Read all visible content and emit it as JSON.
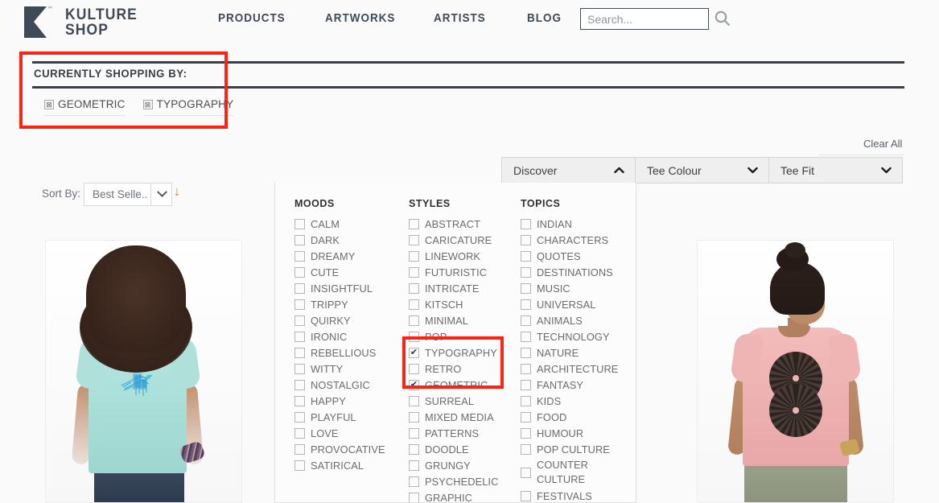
{
  "header": {
    "brand_line1": "KULTURE",
    "brand_line2": "SHOP",
    "brand_tm": "™",
    "nav": [
      {
        "label": "PRODUCTS",
        "name": "nav-products"
      },
      {
        "label": "ARTWORKS",
        "name": "nav-artworks"
      },
      {
        "label": "ARTISTS",
        "name": "nav-artists"
      },
      {
        "label": "BLOG",
        "name": "nav-blog"
      }
    ],
    "search": {
      "value": "",
      "placeholder": "Search...",
      "icon": "search-icon"
    }
  },
  "currently_shopping": {
    "title": "CURRENTLY SHOPPING BY:",
    "chips": [
      {
        "label": "GEOMETRIC",
        "remove_icon": "x-box-icon"
      },
      {
        "label": "TYPOGRAPHY",
        "remove_icon": "x-box-icon"
      }
    ]
  },
  "toolbar": {
    "clear_all": "Clear All",
    "sort_label": "Sort By:",
    "sort_value": "Best Selle..",
    "sort_caret_icon": "chevron-down-icon",
    "sort_direction_icon": "arrow-down-icon",
    "filters": [
      {
        "label": "Discover",
        "icon": "chevron-up-icon",
        "expanded": true
      },
      {
        "label": "Tee Colour",
        "icon": "chevron-down-icon",
        "expanded": false
      },
      {
        "label": "Tee Fit",
        "icon": "chevron-down-icon",
        "expanded": false
      }
    ]
  },
  "discover_panel": {
    "columns": [
      {
        "heading": "MOODS",
        "options": [
          {
            "label": "CALM",
            "checked": false
          },
          {
            "label": "DARK",
            "checked": false
          },
          {
            "label": "DREAMY",
            "checked": false
          },
          {
            "label": "CUTE",
            "checked": false
          },
          {
            "label": "INSIGHTFUL",
            "checked": false
          },
          {
            "label": "TRIPPY",
            "checked": false
          },
          {
            "label": "QUIRKY",
            "checked": false
          },
          {
            "label": "IRONIC",
            "checked": false
          },
          {
            "label": "REBELLIOUS",
            "checked": false
          },
          {
            "label": "WITTY",
            "checked": false
          },
          {
            "label": "NOSTALGIC",
            "checked": false
          },
          {
            "label": "HAPPY",
            "checked": false
          },
          {
            "label": "PLAYFUL",
            "checked": false
          },
          {
            "label": "LOVE",
            "checked": false
          },
          {
            "label": "PROVOCATIVE",
            "checked": false
          },
          {
            "label": "SATIRICAL",
            "checked": false
          }
        ]
      },
      {
        "heading": "STYLES",
        "options": [
          {
            "label": "ABSTRACT",
            "checked": false
          },
          {
            "label": "CARICATURE",
            "checked": false
          },
          {
            "label": "LINEWORK",
            "checked": false
          },
          {
            "label": "FUTURISTIC",
            "checked": false
          },
          {
            "label": "INTRICATE",
            "checked": false
          },
          {
            "label": "KITSCH",
            "checked": false
          },
          {
            "label": "MINIMAL",
            "checked": false
          },
          {
            "label": "POP",
            "checked": false
          },
          {
            "label": "TYPOGRAPHY",
            "checked": true
          },
          {
            "label": "RETRO",
            "checked": false
          },
          {
            "label": "GEOMETRIC",
            "checked": true
          },
          {
            "label": "SURREAL",
            "checked": false
          },
          {
            "label": "MIXED MEDIA",
            "checked": false
          },
          {
            "label": "PATTERNS",
            "checked": false
          },
          {
            "label": "DOODLE",
            "checked": false
          },
          {
            "label": "GRUNGY",
            "checked": false
          },
          {
            "label": "PSYCHEDELIC",
            "checked": false
          },
          {
            "label": "GRAPHIC",
            "checked": false
          }
        ]
      },
      {
        "heading": "TOPICS",
        "options": [
          {
            "label": "INDIAN",
            "checked": false
          },
          {
            "label": "CHARACTERS",
            "checked": false
          },
          {
            "label": "QUOTES",
            "checked": false
          },
          {
            "label": "DESTINATIONS",
            "checked": false
          },
          {
            "label": "MUSIC",
            "checked": false
          },
          {
            "label": "UNIVERSAL",
            "checked": false
          },
          {
            "label": "ANIMALS",
            "checked": false
          },
          {
            "label": "TECHNOLOGY",
            "checked": false
          },
          {
            "label": "NATURE",
            "checked": false
          },
          {
            "label": "ARCHITECTURE",
            "checked": false
          },
          {
            "label": "FANTASY",
            "checked": false
          },
          {
            "label": "KIDS",
            "checked": false
          },
          {
            "label": "FOOD",
            "checked": false
          },
          {
            "label": "HUMOUR",
            "checked": false
          },
          {
            "label": "POP CULTURE",
            "checked": false
          },
          {
            "label": "COUNTER CULTURE",
            "checked": false,
            "two_line": true
          },
          {
            "label": "FESTIVALS",
            "checked": false
          }
        ]
      }
    ]
  },
  "products": [
    {
      "name": "product-card-1",
      "tee_colour": "#ade2dc",
      "print": "blue abstract linework"
    },
    {
      "name": "product-card-2",
      "tee_colour": "#efb2b2",
      "print": "two dark textured circles"
    }
  ],
  "annotations": [
    {
      "name": "annotation-currently-shopping",
      "colour": "#fb2412"
    },
    {
      "name": "annotation-styles-selected",
      "colour": "#fb2412"
    }
  ],
  "checkmark_glyph": "✔",
  "chip_remove_glyph": "⊠"
}
